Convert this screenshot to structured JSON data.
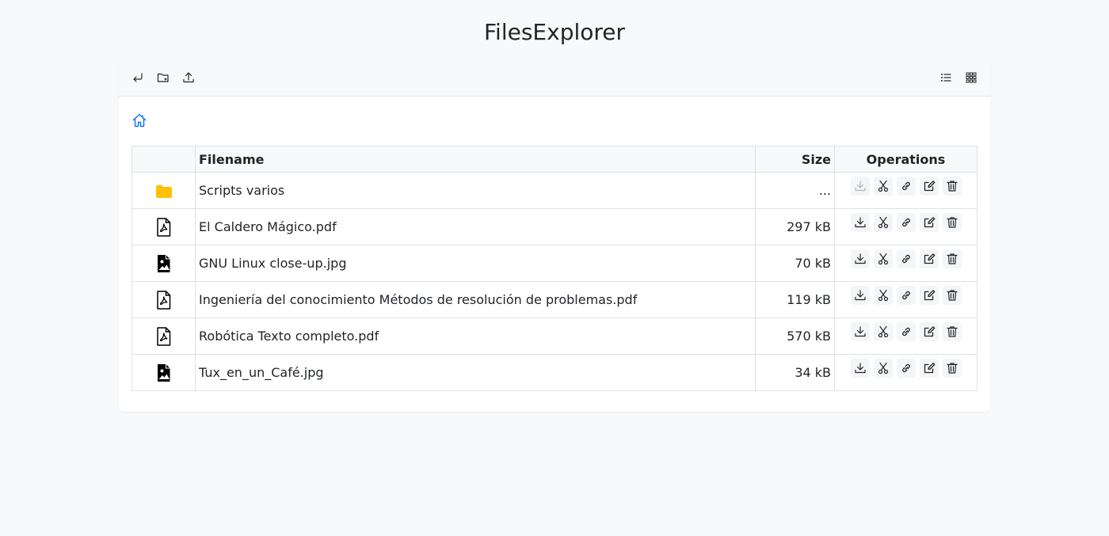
{
  "app": {
    "title": "FilesExplorer"
  },
  "toolbar": {
    "left": [
      {
        "name": "back-button",
        "icon": "return-arrow-icon"
      },
      {
        "name": "new-folder-button",
        "icon": "folder-plus-icon"
      },
      {
        "name": "upload-button",
        "icon": "upload-icon"
      }
    ],
    "right": [
      {
        "name": "list-view-button",
        "icon": "list-icon"
      },
      {
        "name": "grid-view-button",
        "icon": "grid-icon"
      }
    ]
  },
  "breadcrumb": {
    "icon": "home-icon",
    "color": "#0d6efd"
  },
  "table": {
    "headers": {
      "icon": "",
      "filename": "Filename",
      "size": "Size",
      "operations": "Operations"
    },
    "rows": [
      {
        "type": "folder",
        "icon": "folder-icon",
        "name": "Scripts varios",
        "size": "..."
      },
      {
        "type": "pdf",
        "icon": "pdf-file-icon",
        "name": "El Caldero Mágico.pdf",
        "size": "297 kB"
      },
      {
        "type": "image",
        "icon": "image-file-icon",
        "name": "GNU Linux close-up.jpg",
        "size": "70 kB"
      },
      {
        "type": "pdf",
        "icon": "pdf-file-icon",
        "name": "Ingeniería del conocimiento Métodos de resolución de problemas.pdf",
        "size": "119 kB"
      },
      {
        "type": "pdf",
        "icon": "pdf-file-icon",
        "name": "Robótica Texto completo.pdf",
        "size": "570 kB"
      },
      {
        "type": "image",
        "icon": "image-file-icon",
        "name": "Tux_en_un_Café.jpg",
        "size": "34 kB"
      }
    ],
    "operations": [
      "download-icon",
      "cut-icon",
      "link-icon",
      "edit-icon",
      "trash-icon"
    ]
  },
  "colors": {
    "folder": "#ffc107",
    "accent": "#0d6efd",
    "disabled": "#adb5bd"
  }
}
